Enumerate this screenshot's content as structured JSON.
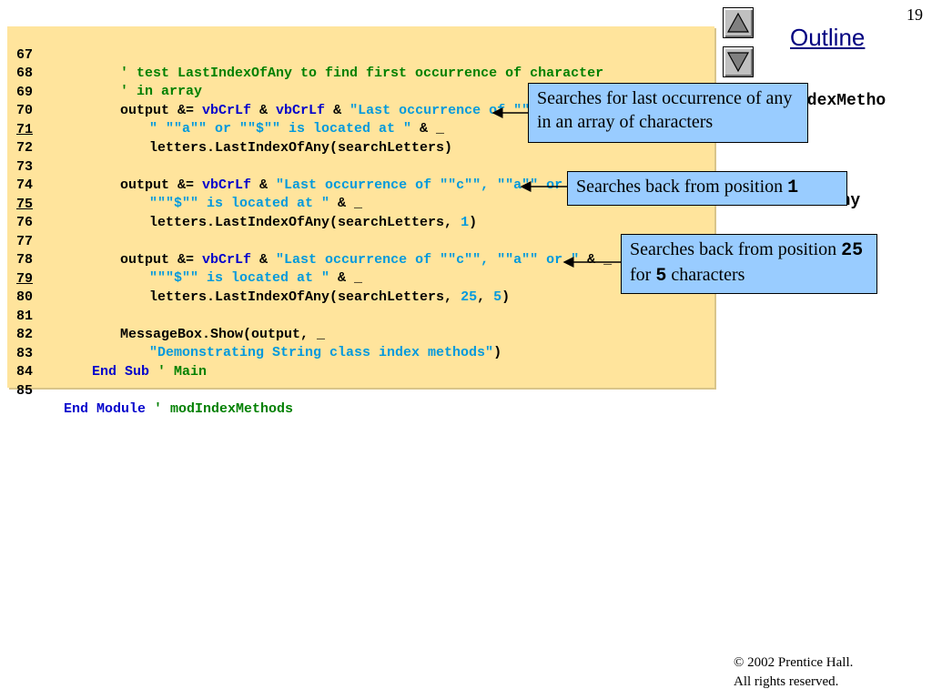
{
  "page_number": "19",
  "outline_label": "Outline",
  "side_labels": {
    "file_name": "ndexMetho",
    "method_name": "LastIndexOfAny"
  },
  "code_lines": [
    {
      "num": "67",
      "text": "' test LastIndexOfAny to find first occurrence of character"
    },
    {
      "num": "68",
      "text": "' in array"
    },
    {
      "num": "69",
      "text": "output &= vbCrLf & vbCrLf & \"Last occurrence of \"\"c\"\",\" &"
    },
    {
      "num": "70",
      "text": "\" \"\"a\"\" or \"\"$\"\" is located at \" & _"
    },
    {
      "num": "71",
      "text": "letters.LastIndexOfAny(searchLetters)"
    },
    {
      "num": "72",
      "text": ""
    },
    {
      "num": "73",
      "text": "output &= vbCrLf & \"Last occurrence of \"\"c\"\", \"\"a\"\" or \" & _"
    },
    {
      "num": "74",
      "text": "\"\"\"$\"\" is located at \" & _"
    },
    {
      "num": "75",
      "text": "letters.LastIndexOfAny(searchLetters, 1)"
    },
    {
      "num": "76",
      "text": ""
    },
    {
      "num": "77",
      "text": "output &= vbCrLf & \"Last occurrence of \"\"c\"\", \"\"a\"\" or \" & _"
    },
    {
      "num": "78",
      "text": "\"\"\"$\"\" is located at \" & _"
    },
    {
      "num": "79",
      "text": "letters.LastIndexOfAny(searchLetters, 25, 5)"
    },
    {
      "num": "80",
      "text": ""
    },
    {
      "num": "81",
      "text": "MessageBox.Show(output, _"
    },
    {
      "num": "82",
      "text": "\"Demonstrating String class index methods\")"
    },
    {
      "num": "83",
      "text": "End Sub ' Main"
    },
    {
      "num": "84",
      "text": ""
    },
    {
      "num": "85",
      "text": "End Module ' modIndexMethods"
    }
  ],
  "callouts": {
    "c1": {
      "text": "Searches for last occurrence of any in an array of characters"
    },
    "c2": {
      "text": "Searches back from position ",
      "code": "1"
    },
    "c3": {
      "text_before": "Searches back from position ",
      "code1": "25",
      "text_mid": " for ",
      "code2": "5",
      "text_after": " characters"
    }
  },
  "footer": {
    "line1": "© 2002 Prentice Hall.",
    "line2": "All rights reserved."
  },
  "colors": {
    "code_background": "#ffe49c",
    "callout_background": "#99ccff",
    "keyword": "#0000cc",
    "comment": "#008000",
    "string": "#0099dd"
  }
}
